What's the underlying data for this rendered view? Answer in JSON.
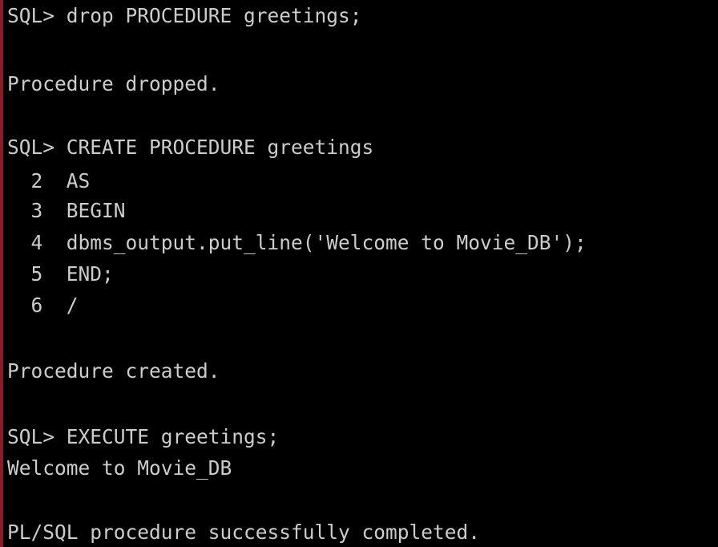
{
  "terminal": {
    "lines": [
      "SQL> drop PROCEDURE greetings;",
      "Procedure dropped.",
      "SQL> CREATE PROCEDURE greetings",
      "  2  AS",
      "  3  BEGIN",
      "  4  dbms_output.put_line('Welcome to Movie_DB');",
      "  5  END;",
      "  6  /",
      "Procedure created.",
      "SQL> EXECUTE greetings;",
      "Welcome to Movie_DB",
      "PL/SQL procedure successfully completed."
    ]
  },
  "colors": {
    "background": "#000000",
    "text": "#cccccc",
    "window_edge": "#8a1c2a"
  }
}
